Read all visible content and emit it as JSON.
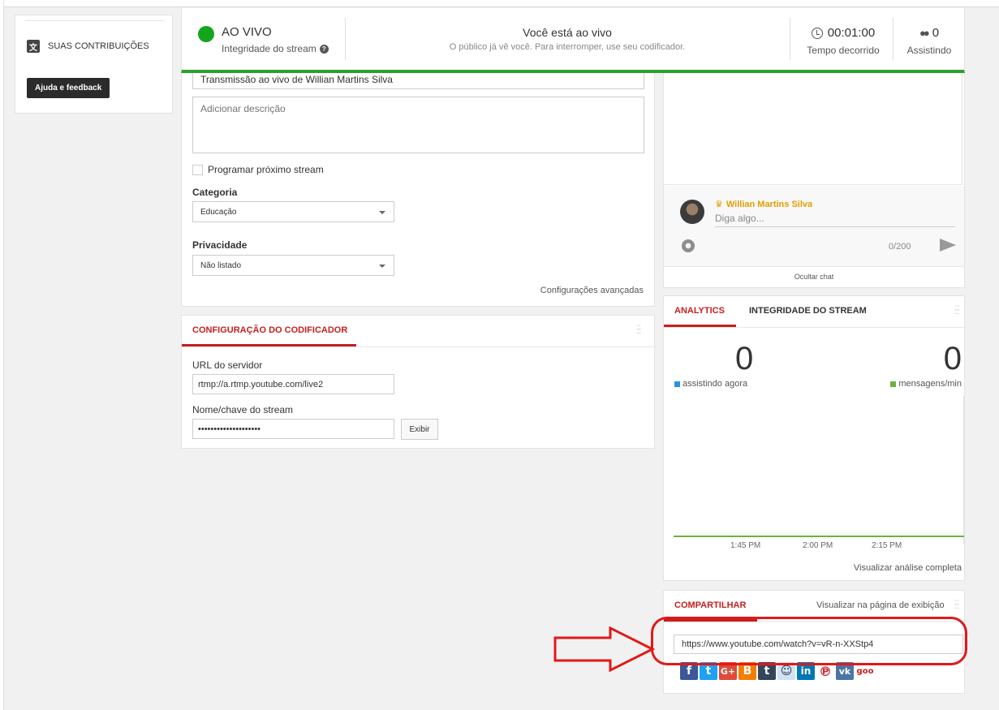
{
  "sidebar": {
    "contributions_label": "SUAS CONTRIBUIÇÕES",
    "translate_icon": "translate-icon",
    "help_button": "Ajuda e feedback"
  },
  "status": {
    "live_label": "AO VIVO",
    "integrity_label": "Integridade do stream",
    "headline": "Você está ao vivo",
    "subline": "O público já vê você. Para interromper, use seu codificador.",
    "elapsed_value": "00:01:00",
    "elapsed_label": "Tempo decorrido",
    "viewers_value": "0",
    "viewers_label": "Assistindo",
    "live_color": "#14a51b"
  },
  "info": {
    "title_value": "Transmissão ao vivo de Willian Martins Silva",
    "description_placeholder": "Adicionar descrição",
    "schedule_label": "Programar próximo stream",
    "category_label": "Categoria",
    "category_value": "Educação",
    "privacy_label": "Privacidade",
    "privacy_value": "Não listado",
    "advanced_link": "Configurações avançadas"
  },
  "encoder": {
    "tab_label": "CONFIGURAÇÃO DO CODIFICADOR",
    "server_url_label": "URL do servidor",
    "server_url_value": "rtmp://a.rtmp.youtube.com/live2",
    "stream_key_label": "Nome/chave do stream",
    "stream_key_value": "••••••••••••••••••••",
    "show_button": "Exibir"
  },
  "chat": {
    "user_name": "Willian Martins Silva",
    "input_placeholder": "Diga algo...",
    "char_count": "0/200",
    "hide_label": "Ocultar chat"
  },
  "analytics": {
    "tab_analytics": "ANALYTICS",
    "tab_integrity": "INTEGRIDADE DO STREAM",
    "watching_value": "0",
    "watching_label": "assistindo agora",
    "messages_value": "0",
    "messages_label": "mensagens/min",
    "ticks": [
      "1:45 PM",
      "2:00 PM",
      "2:15 PM"
    ],
    "full_link": "Visualizar análise completa",
    "accent_color": "#c81e1e",
    "watching_color": "#2793e6",
    "messages_color": "#6cb33e"
  },
  "share": {
    "tab_label": "COMPARTILHAR",
    "watch_link": "Visualizar na página de exibição",
    "url_value": "https://www.youtube.com/watch?v=vR-n-XXStp4",
    "more_label": "goo"
  }
}
